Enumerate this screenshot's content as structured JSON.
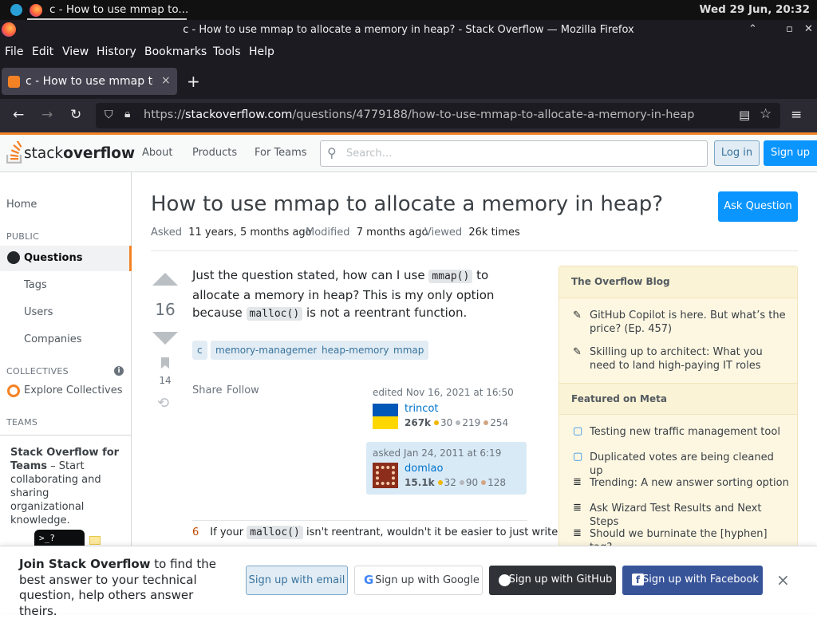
{
  "os_bar": {
    "tab_title": "c - How to use mmap to...",
    "clock": "Wed 29 Jun, 20:32"
  },
  "window": {
    "title": "c - How to use mmap to allocate a memory in heap? - Stack Overflow — Mozilla Firefox"
  },
  "menu": [
    "File",
    "Edit",
    "View",
    "History",
    "Bookmarks",
    "Tools",
    "Help"
  ],
  "tab": {
    "title": "c - How to use mmap to",
    "close": "×",
    "new": "+"
  },
  "url": {
    "prefix": "https://",
    "domain": "stackoverflow.com",
    "path": "/questions/4779188/how-to-use-mmap-to-allocate-a-memory-in-heap"
  },
  "so_header": {
    "logo_light": "stack",
    "logo_bold": "overflow",
    "nav": [
      "About",
      "Products",
      "For Teams"
    ],
    "search_placeholder": "Search…",
    "login": "Log in",
    "signup": "Sign up"
  },
  "leftnav": {
    "home": "Home",
    "public": "PUBLIC",
    "questions": "Questions",
    "tags": "Tags",
    "users": "Users",
    "companies": "Companies",
    "collectives": "COLLECTIVES",
    "explore": "Explore Collectives",
    "teams": "TEAMS",
    "teams_title": "Stack Overflow for Teams",
    "teams_text": "– Start collaborating and sharing organizational knowledge."
  },
  "question": {
    "title": "How to use mmap to allocate a memory in heap?",
    "ask_button": "Ask Question",
    "asked_label": "Asked",
    "asked_value": "11 years, 5 months ago",
    "modified_label": "Modified",
    "modified_value": "7 months ago",
    "viewed_label": "Viewed",
    "viewed_value": "26k times",
    "score": "16",
    "bookmarks": "14",
    "body_1": "Just the question stated, how can I use",
    "code_1": "mmap()",
    "body_2": "to allocate a memory in heap? This is my only option because",
    "code_2": "malloc()",
    "body_3": "is not a reentrant function.",
    "tags": [
      "c",
      "memory-management",
      "heap-memory",
      "mmap"
    ],
    "share": "Share",
    "follow": "Follow",
    "edited": "edited Nov 16, 2021 at 16:50",
    "editor": {
      "name": "trincot",
      "rep": "267k",
      "gold": "30",
      "silver": "219",
      "bronze": "254"
    },
    "asked_card": "asked Jan 24, 2011 at 6:19",
    "asker": {
      "name": "domlao",
      "rep": "15.1k",
      "gold": "32",
      "silver": "90",
      "bronze": "128"
    }
  },
  "comment": {
    "score": "6",
    "text_1": "If your",
    "code": "malloc()",
    "text_2": "isn't reentrant, wouldn't it be easier to just write"
  },
  "sidebar": {
    "blog_title": "The Overflow Blog",
    "blog": [
      "GitHub Copilot is here. But what’s the price? (Ep. 457)",
      "Skilling up to architect: What you need to land high-paying IT roles"
    ],
    "meta_title": "Featured on Meta",
    "meta": [
      "Testing new traffic management tool",
      "Duplicated votes are being cleaned up",
      "Trending: A new answer sorting option",
      "Ask Wizard Test Results and Next Steps",
      "Should we burninate the [hyphen] tag?"
    ]
  },
  "banner": {
    "bold": "Join Stack Overflow",
    "text": " to find the best answer to your technical question, help others answer theirs.",
    "email": "Sign up with email",
    "google": "Sign up with Google",
    "github": "Sign up with GitHub",
    "facebook": "Sign up with Facebook",
    "close": "×"
  },
  "colors": {
    "accent": "#f48225",
    "primary": "#0a95ff",
    "gold": "#f1b600",
    "silver": "#b4b8bc",
    "bronze": "#d1a684"
  }
}
